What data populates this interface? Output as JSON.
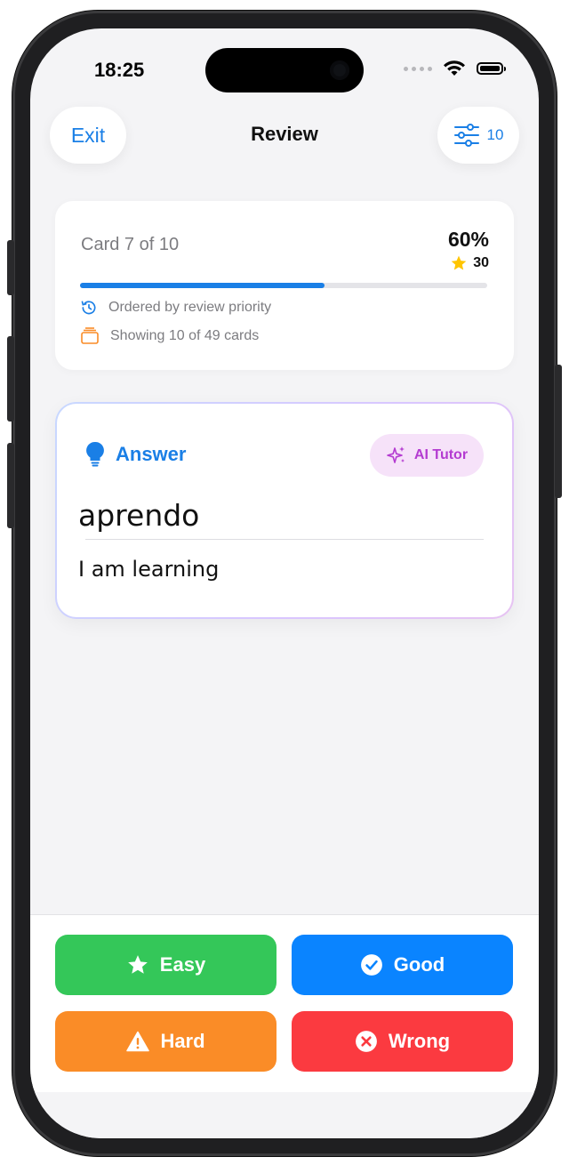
{
  "status_bar": {
    "time": "18:25"
  },
  "nav": {
    "exit_label": "Exit",
    "title": "Review",
    "filter_count": "10"
  },
  "progress": {
    "card_label": "Card 7 of 10",
    "percent_label": "60%",
    "progress_fraction": 0.6,
    "stars": "30",
    "order_note": "Ordered by review priority",
    "showing_note": "Showing 10 of 49 cards"
  },
  "answer": {
    "label": "Answer",
    "ai_tutor_label": "AI Tutor",
    "term": "aprendo",
    "meaning": "I am learning"
  },
  "grades": {
    "easy": "Easy",
    "good": "Good",
    "hard": "Hard",
    "wrong": "Wrong"
  },
  "colors": {
    "accent": "#1a7fe6",
    "easy": "#34c759",
    "good": "#0a84ff",
    "hard": "#fa8c27",
    "wrong": "#fb3a40",
    "ai_tutor": "#b43bd1"
  }
}
